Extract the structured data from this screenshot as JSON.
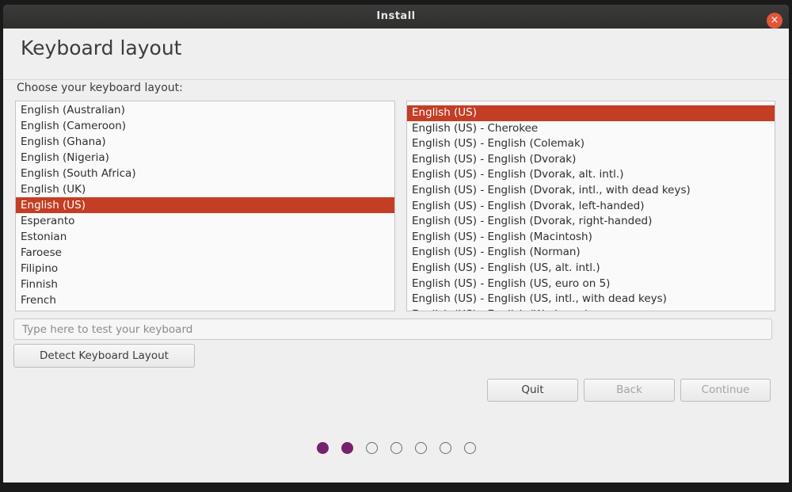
{
  "window": {
    "title": "Install",
    "close_glyph": "×"
  },
  "page": {
    "heading": "Keyboard layout",
    "prompt": "Choose your keyboard layout:"
  },
  "layouts": [
    "English (Australian)",
    "English (Cameroon)",
    "English (Ghana)",
    "English (Nigeria)",
    "English (South Africa)",
    "English (UK)",
    "English (US)",
    "Esperanto",
    "Estonian",
    "Faroese",
    "Filipino",
    "Finnish",
    "French"
  ],
  "selected_layout": "English (US)",
  "variants": [
    "English (US)",
    "English (US) - Cherokee",
    "English (US) - English (Colemak)",
    "English (US) - English (Dvorak)",
    "English (US) - English (Dvorak, alt. intl.)",
    "English (US) - English (Dvorak, intl., with dead keys)",
    "English (US) - English (Dvorak, left-handed)",
    "English (US) - English (Dvorak, right-handed)",
    "English (US) - English (Macintosh)",
    "English (US) - English (Norman)",
    "English (US) - English (US, alt. intl.)",
    "English (US) - English (US, euro on 5)",
    "English (US) - English (US, intl., with dead keys)",
    "English (US) - English (Workman)"
  ],
  "selected_variant": "English (US)",
  "test_input": {
    "value": "",
    "placeholder": "Type here to test your keyboard"
  },
  "buttons": {
    "detect": "Detect Keyboard Layout",
    "quit": "Quit",
    "back": "Back",
    "continue": "Continue"
  },
  "progress": {
    "total_steps": 7,
    "completed_steps": 2
  },
  "colors": {
    "selection": "#c43d25",
    "progress_dot": "#77216f"
  }
}
